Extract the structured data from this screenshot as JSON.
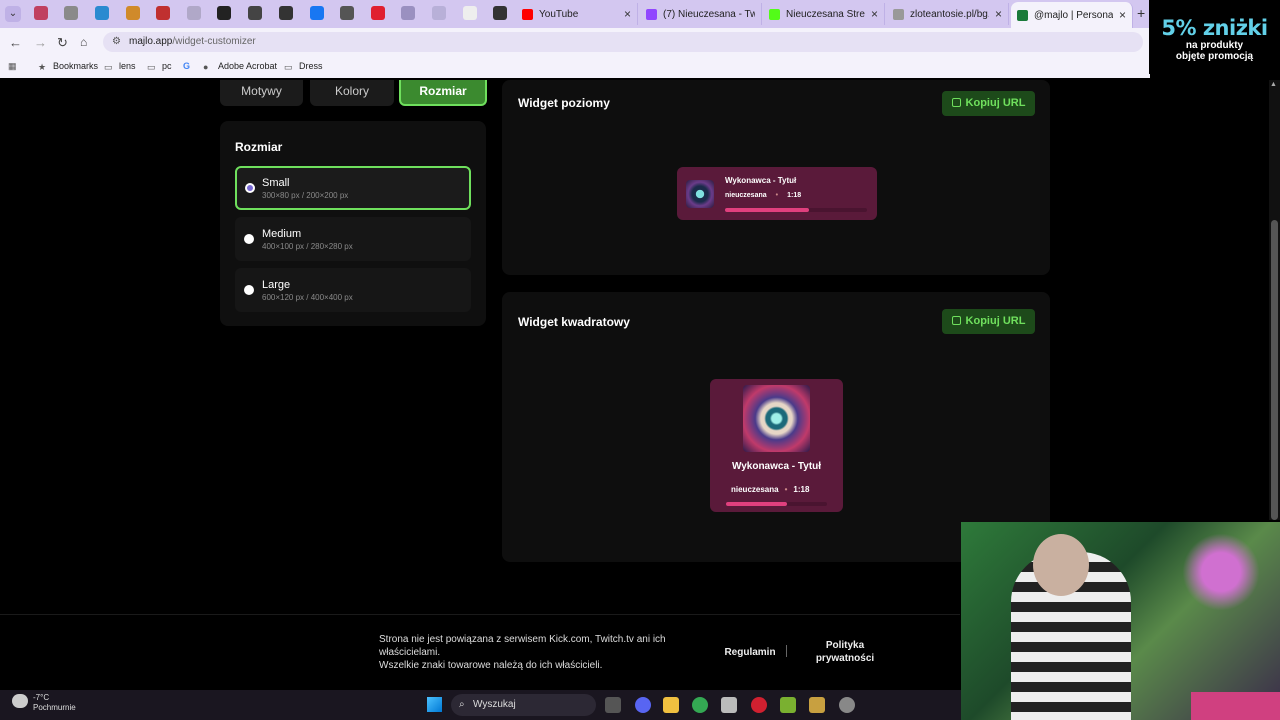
{
  "browser": {
    "tabs": [
      {
        "title": "YouTube",
        "favicon_color": "#ff0000"
      },
      {
        "title": "(7) Nieuczesana - Twi",
        "favicon_color": "#9146ff"
      },
      {
        "title": "Nieuczesana Stream",
        "favicon_color": "#53fc18"
      },
      {
        "title": "zloteantosie.pl/bg.we",
        "favicon_color": "#999999"
      },
      {
        "title": "@majlo | Personaliza",
        "favicon_color": "#1a7a3a"
      }
    ],
    "close_symbol": "×",
    "new_tab_symbol": "+",
    "address_host": "majlo.app",
    "address_path": "/widget-customizer",
    "bookmarks": [
      {
        "label": "Bookmarks",
        "icon": "star-icon"
      },
      {
        "label": "lens",
        "icon": "folder-icon"
      },
      {
        "label": "pc",
        "icon": "folder-icon"
      },
      {
        "label": "",
        "icon": "google-icon"
      },
      {
        "label": "Adobe Acrobat",
        "icon": "acrobat-icon"
      },
      {
        "label": "Dress",
        "icon": "folder-icon"
      }
    ]
  },
  "promo": {
    "big": "5% zniżki",
    "line1": "na produkty",
    "line2": "objęte promocją"
  },
  "tabs": {
    "motywy": "Motywy",
    "kolory": "Kolory",
    "rozmiar": "Rozmiar"
  },
  "size_panel": {
    "title": "Rozmiar",
    "options": [
      {
        "label": "Small",
        "dims": "300×80 px / 200×200 px",
        "selected": true
      },
      {
        "label": "Medium",
        "dims": "400×100 px / 280×280 px",
        "selected": false
      },
      {
        "label": "Large",
        "dims": "600×120 px / 400×400 px",
        "selected": false
      }
    ]
  },
  "horizontal": {
    "title": "Widget poziomy",
    "copy_label": "Kopiuj URL",
    "track_title": "Wykonawca - Tytuł",
    "artist": "nieuczesana",
    "time": "1:18",
    "progress": 0.59
  },
  "square": {
    "title": "Widget kwadratowy",
    "copy_label": "Kopiuj URL",
    "track_title": "Wykonawca - Tytuł",
    "artist": "nieuczesana",
    "time": "1:18",
    "progress": 0.6
  },
  "footer": {
    "disclaimer1": "Strona nie jest powiązana z serwisem Kick.com, Twitch.tv ani ich właścicielami.",
    "disclaimer2": "Wszelkie znaki towarowe należą do ich właścicieli.",
    "terms": "Regulamin",
    "privacy1": "Polityka",
    "privacy2": "prywatności"
  },
  "taskbar": {
    "temp": "-7°C",
    "weather": "Pochmurnie",
    "search": "Wyszukaj"
  },
  "colors": {
    "accent": "#6fe05d",
    "widget_bg": "#5a1a3a",
    "progress": "#e0407e"
  }
}
